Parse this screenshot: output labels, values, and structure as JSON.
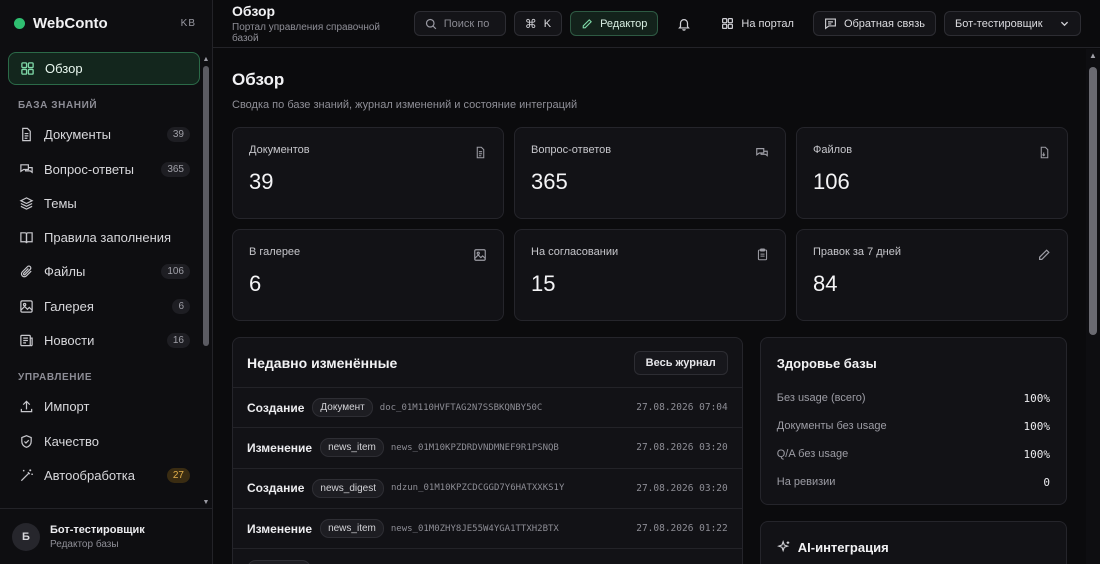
{
  "brand": {
    "name": "WebConto",
    "initials": "KB"
  },
  "sidebar": {
    "items_top": [
      {
        "label": "Обзор",
        "icon": "grid-icon",
        "active": true
      }
    ],
    "section_kb": "База знаний",
    "items_kb": [
      {
        "label": "Документы",
        "icon": "document-icon",
        "count": "39"
      },
      {
        "label": "Вопрос-ответы",
        "icon": "chat-icon",
        "count": "365"
      },
      {
        "label": "Темы",
        "icon": "layers-icon",
        "count": ""
      },
      {
        "label": "Правила заполнения",
        "icon": "book-icon",
        "count": ""
      },
      {
        "label": "Файлы",
        "icon": "paperclip-icon",
        "count": "106"
      },
      {
        "label": "Галерея",
        "icon": "images-icon",
        "count": "6"
      },
      {
        "label": "Новости",
        "icon": "newspaper-icon",
        "count": "16"
      }
    ],
    "section_mgmt": "Управление",
    "items_mgmt": [
      {
        "label": "Импорт",
        "icon": "upload-icon",
        "count": ""
      },
      {
        "label": "Качество",
        "icon": "shield-icon",
        "count": ""
      },
      {
        "label": "Автообработка",
        "icon": "magic-wand-icon",
        "count": "27"
      }
    ]
  },
  "user": {
    "avatar": "Б",
    "name": "Бот-тестировщик",
    "role": "Редактор базы"
  },
  "topbar": {
    "title": "Обзор",
    "subtitle": "Портал управления справочной базой",
    "search_placeholder": "Поиск по",
    "shortcut": "K",
    "editor": "Редактор",
    "portal": "На портал",
    "feedback": "Обратная связь",
    "profile": "Бот-тестировщик"
  },
  "page": {
    "title": "Обзор",
    "subtitle": "Сводка по базе знаний, журнал изменений и состояние интеграций"
  },
  "stats": [
    {
      "label": "Документов",
      "value": "39",
      "icon": "document-icon"
    },
    {
      "label": "Вопрос-ответов",
      "value": "365",
      "icon": "chat-icon"
    },
    {
      "label": "Файлов",
      "value": "106",
      "icon": "file-icon"
    },
    {
      "label": "В галерее",
      "value": "6",
      "icon": "images-icon"
    },
    {
      "label": "На согласовании",
      "value": "15",
      "icon": "clipboard-icon"
    },
    {
      "label": "Правок за 7 дней",
      "value": "84",
      "icon": "pencil-icon"
    }
  ],
  "recent": {
    "title": "Недавно изменённые",
    "button": "Весь журнал",
    "rows": [
      {
        "action": "Создание",
        "type": "Документ",
        "id": "doc_01M110HVFTAG2N7SSBKQNBY50C",
        "ts": "27.08.2026 07:04"
      },
      {
        "action": "Изменение",
        "type": "news_item",
        "id": "news_01M10KPZDRDVNDMNEF9R1PSNQB",
        "ts": "27.08.2026 03:20"
      },
      {
        "action": "Создание",
        "type": "news_digest",
        "id": "ndzun_01M10KPZCDCGGD7Y6HATXXKS1Y",
        "ts": "27.08.2026 03:20"
      },
      {
        "action": "Изменение",
        "type": "news_item",
        "id": "news_01M0ZHY8JE55W4YGA1TTXH2BTX",
        "ts": "27.08.2026 01:22"
      },
      {
        "action": "",
        "type": "",
        "id": "",
        "ts": ""
      }
    ]
  },
  "health": {
    "title": "Здоровье базы",
    "rows": [
      {
        "label": "Без usage (всего)",
        "value": "100%"
      },
      {
        "label": "Документы без usage",
        "value": "100%"
      },
      {
        "label": "Q/A без usage",
        "value": "100%"
      },
      {
        "label": "На ревизии",
        "value": "0"
      }
    ]
  },
  "ai": {
    "title": "AI-интеграция"
  },
  "colors": {
    "accent": "#2fbf71",
    "bg": "#0b0b0d",
    "card": "#121216",
    "warn": "#e3b04b"
  }
}
